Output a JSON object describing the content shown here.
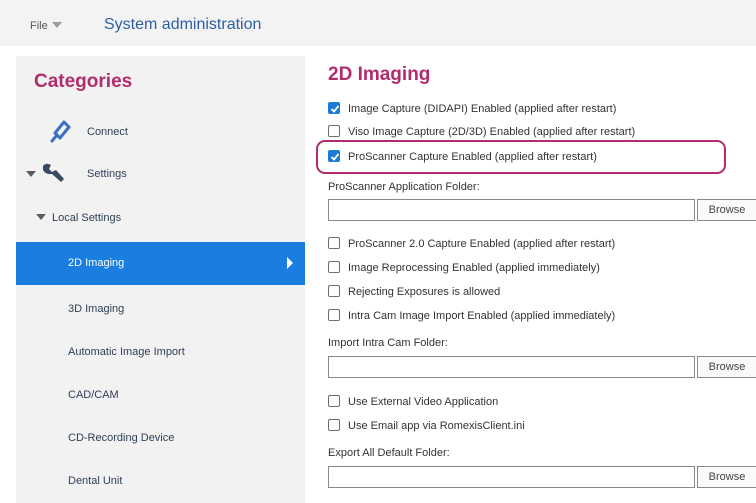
{
  "header": {
    "file_label": "File",
    "title": "System administration"
  },
  "sidebar": {
    "title": "Categories",
    "items": [
      {
        "label": "Connect",
        "icon": "connect-icon"
      },
      {
        "label": "Settings",
        "icon": "wrench-icon"
      },
      {
        "label": "Local Settings"
      },
      {
        "label": "2D Imaging",
        "selected": true
      },
      {
        "label": "3D Imaging"
      },
      {
        "label": "Automatic Image Import"
      },
      {
        "label": "CAD/CAM"
      },
      {
        "label": "CD-Recording Device"
      },
      {
        "label": "Dental Unit"
      }
    ]
  },
  "main": {
    "title": "2D Imaging",
    "options": [
      {
        "label": "Image Capture (DIDAPI) Enabled (applied after restart)",
        "checked": true
      },
      {
        "label": "Viso Image Capture (2D/3D) Enabled (applied after restart)",
        "checked": false
      },
      {
        "label": "ProScanner Capture Enabled (applied after restart)",
        "checked": true
      },
      {
        "label": "ProScanner 2.0 Capture Enabled (applied after restart)",
        "checked": false
      },
      {
        "label": "Image Reprocessing Enabled (applied immediately)",
        "checked": false
      },
      {
        "label": "Rejecting Exposures is allowed",
        "checked": false
      },
      {
        "label": "Intra Cam Image Import Enabled (applied immediately)",
        "checked": false
      },
      {
        "label": "Use External Video Application",
        "checked": false
      },
      {
        "label": "Use Email app via RomexisClient.ini",
        "checked": false
      }
    ],
    "proscanner_folder": {
      "label": "ProScanner Application Folder:",
      "value": ""
    },
    "intracam_folder": {
      "label": "Import Intra Cam Folder:",
      "value": ""
    },
    "export_folder": {
      "label": "Export All Default Folder:",
      "value": ""
    },
    "browse_label": "Browse"
  },
  "colors": {
    "accent": "#b12c6f",
    "selection": "#1a7de0",
    "title_blue": "#2d5fa6"
  }
}
